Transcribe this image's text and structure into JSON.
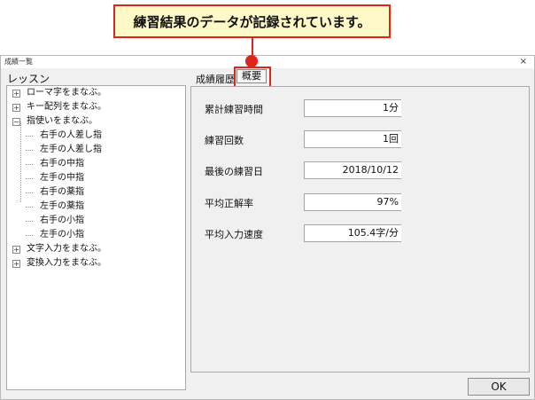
{
  "callout": {
    "text": "練習結果のデータが記録されています。"
  },
  "window": {
    "title": "成績一覧",
    "close": "×"
  },
  "lessons": {
    "title": "レッスン",
    "items": [
      {
        "label": "ローマ字をまなぶ。",
        "expander": "+"
      },
      {
        "label": "キー配列をまなぶ。",
        "expander": "+"
      },
      {
        "label": "指使いをまなぶ。",
        "expander": "−"
      },
      {
        "label": "右手の人差し指"
      },
      {
        "label": "左手の人差し指"
      },
      {
        "label": "右手の中指"
      },
      {
        "label": "左手の中指"
      },
      {
        "label": "右手の薬指"
      },
      {
        "label": "左手の薬指"
      },
      {
        "label": "右手の小指"
      },
      {
        "label": "左手の小指"
      },
      {
        "label": "文字入力をまなぶ。",
        "expander": "+"
      },
      {
        "label": "変換入力をまなぶ。",
        "expander": "+"
      }
    ]
  },
  "tabs": {
    "history": "成績履歴",
    "summary": "概要"
  },
  "summary": {
    "fields": [
      {
        "label": "累計練習時間",
        "value": "1分"
      },
      {
        "label": "練習回数",
        "value": "1回"
      },
      {
        "label": "最後の練習日",
        "value": "2018/10/12"
      },
      {
        "label": "平均正解率",
        "value": "97%"
      },
      {
        "label": "平均入力速度",
        "value": "105.4字/分"
      }
    ]
  },
  "ok_button": "OK",
  "colors": {
    "accent": "#e0241c",
    "callout_bg": "#fff9c8"
  }
}
